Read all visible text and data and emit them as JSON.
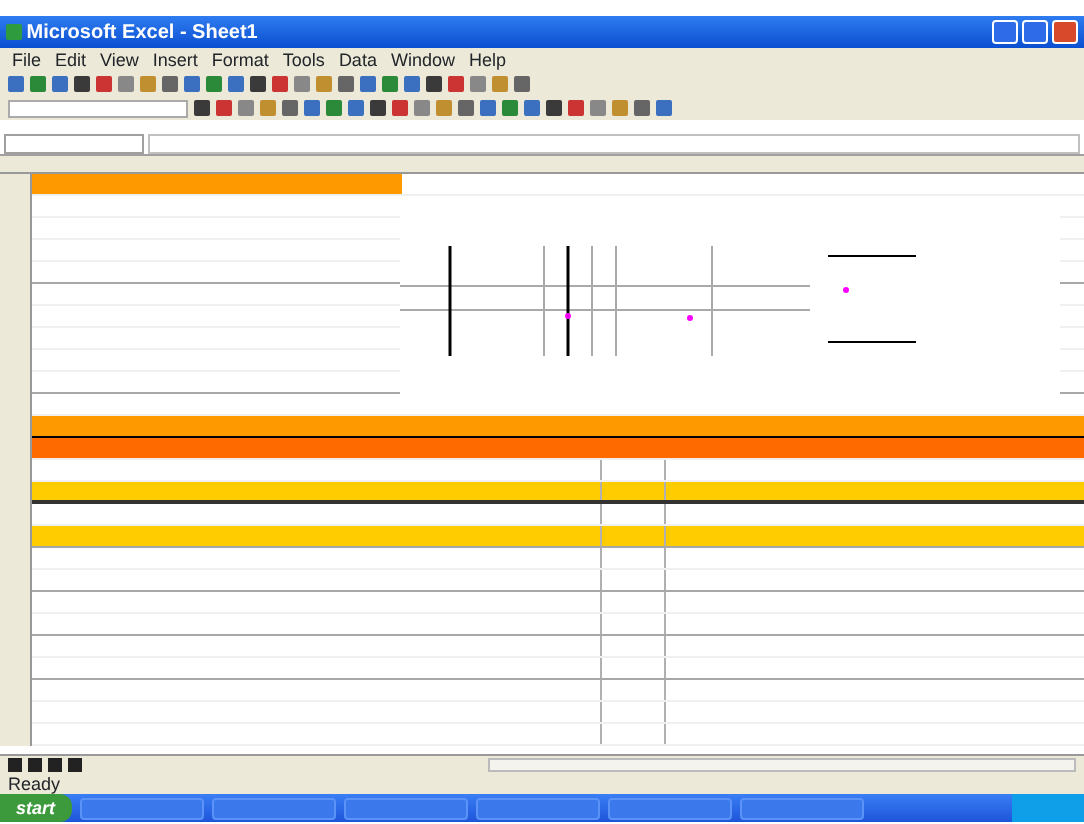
{
  "window": {
    "title": "Microsoft Excel - Sheet1"
  },
  "menu": [
    "File",
    "Edit",
    "View",
    "Insert",
    "Format",
    "Tools",
    "Data",
    "Window",
    "Help"
  ],
  "status_bar": {
    "text": "Ready"
  },
  "taskbar": {
    "start_label": "start"
  }
}
